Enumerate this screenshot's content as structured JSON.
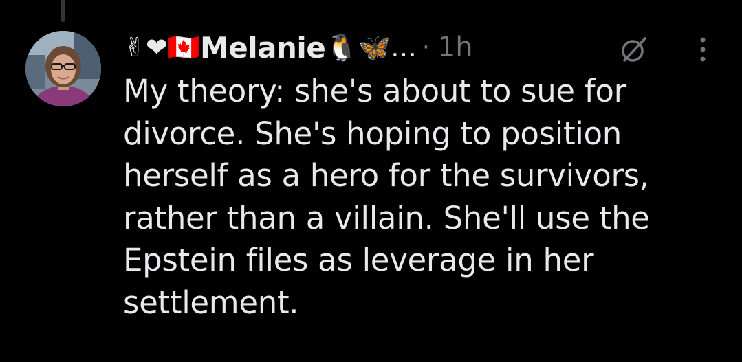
{
  "reply": {
    "author": {
      "emoji_prefix": "✌❤🇨🇦",
      "name": "Melanie",
      "emoji_suffix": "🐧🦋…",
      "avatar": "profile-photo"
    },
    "separator": "·",
    "timestamp": "1h",
    "icons": {
      "grok": "grok-icon",
      "more": "more-options-icon"
    },
    "text": "My theory: she's about to sue for\ndivorce. She's hoping to position\nherself as a hero for the survivors,\nrather than a villain. She'll use the\nEpstein files as leverage in her\nsettlement."
  },
  "colors": {
    "background": "#000000",
    "text": "#e7e9ea",
    "muted": "#71767b",
    "thread_line": "#333639"
  }
}
